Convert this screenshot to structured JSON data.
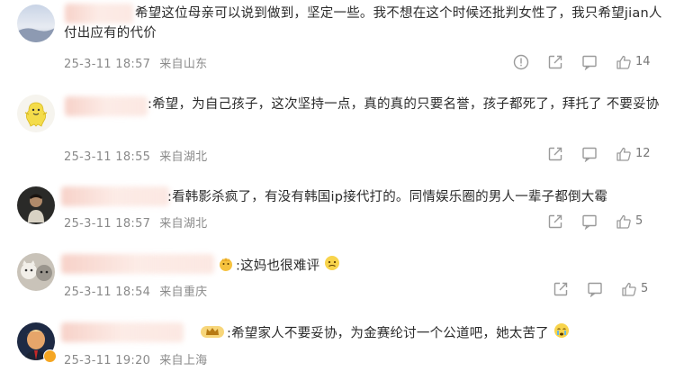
{
  "comments": [
    {
      "text": "希望这位母亲可以说到做到，坚定一些。我不想在这个时候还批判女性了，我只希望jian人付出应有的代价",
      "date": "25-3-11 18:57",
      "location": "来自山东",
      "likes": "14"
    },
    {
      "text": ":希望，为自己孩子，这次坚持一点，真的真的只要名誉，孩子都死了，拜托了 不要妥协",
      "date": "25-3-11 18:55",
      "location": "来自湖北",
      "likes": "12"
    },
    {
      "text": ":看韩影杀疯了，有没有韩国ip接代打的。同情娱乐圈的男人一辈子都倒大霉",
      "date": "25-3-11 18:57",
      "location": "来自湖北",
      "likes": "5"
    },
    {
      "text": ":这妈也很难评",
      "date": "25-3-11 18:54",
      "location": "来自重庆",
      "likes": "5"
    },
    {
      "text": ":希望家人不要妥协，为金赛纶讨一个公道吧，她太苦了",
      "date": "25-3-11 19:20",
      "location": "来自上海",
      "likes": "4"
    }
  ],
  "icons": {
    "report": "exclamation-circle-icon",
    "share": "share-arrow-icon",
    "comment": "comment-bubble-icon",
    "like": "thumbs-up-icon"
  },
  "colors": {
    "text": "#2b2b2b",
    "meta": "#8a8a8a",
    "icon": "#9a9a9a"
  }
}
